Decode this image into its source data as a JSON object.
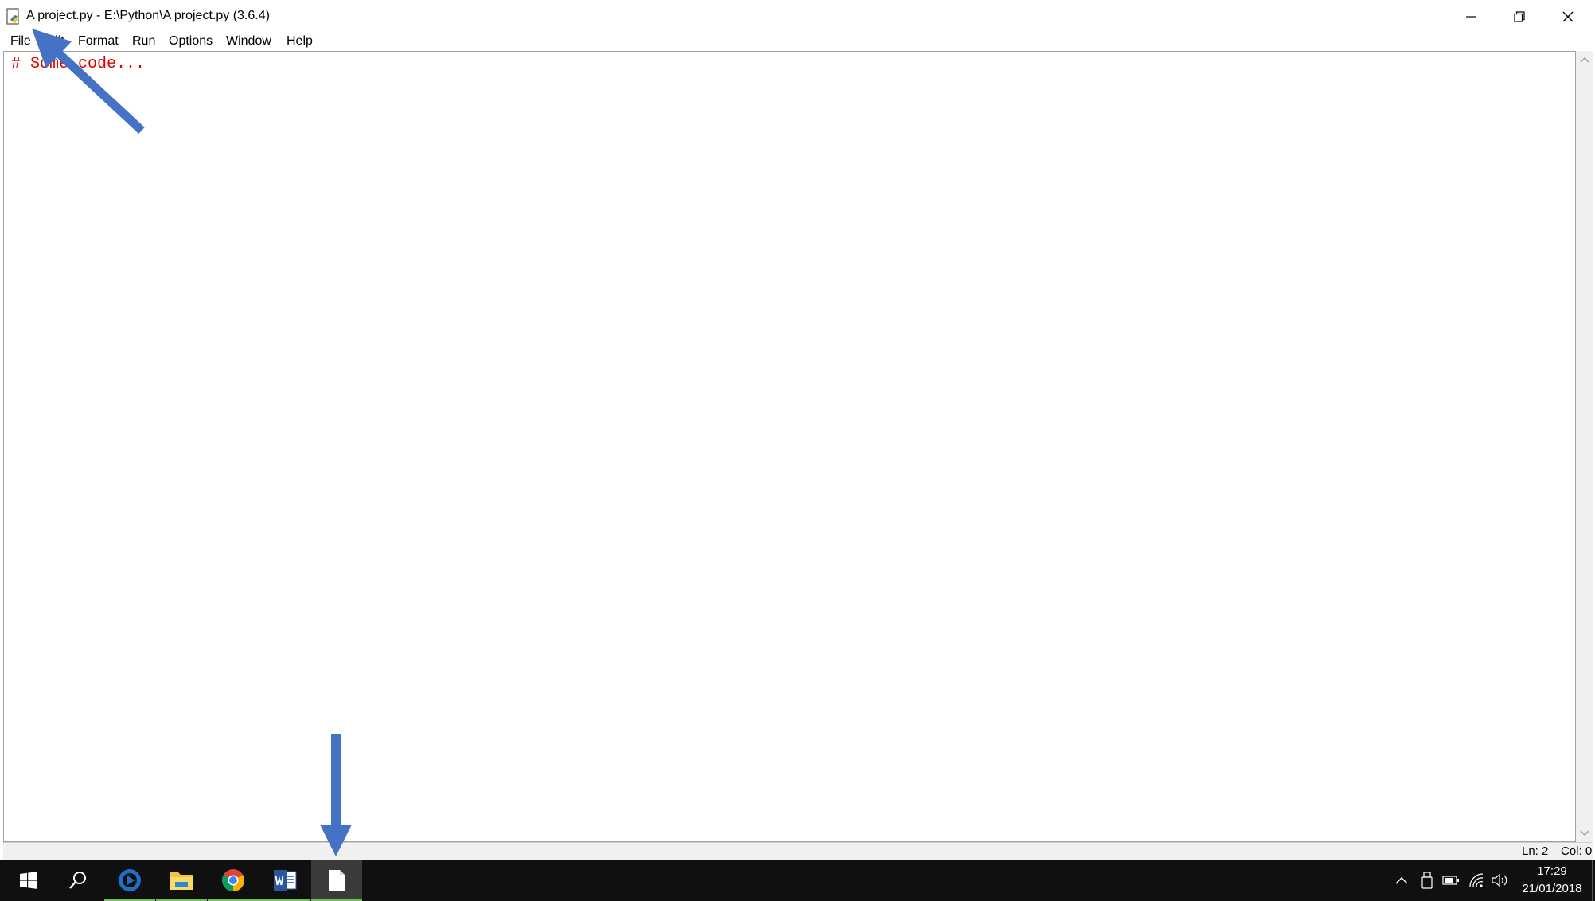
{
  "window": {
    "title": "A project.py - E:\\Python\\A project.py (3.6.4)",
    "controls": [
      "minimize-icon",
      "restore-icon",
      "close-icon"
    ]
  },
  "menu": {
    "file": "File",
    "edit": "Edit",
    "format": "Format",
    "run": "Run",
    "options": "Options",
    "window": "Window",
    "help": "Help"
  },
  "editor": {
    "code": "# Some code...",
    "code_color": "#dd0000"
  },
  "status": {
    "line": "Ln: 2",
    "col": "Col: 0"
  },
  "taskbar": {
    "apps": [
      "windows-start-icon",
      "search-icon",
      "cortana-icon",
      "file-explorer-icon",
      "chrome-icon",
      "word-icon",
      "idle-document-icon"
    ],
    "tray": [
      "chevron-up-icon",
      "usb-icon",
      "battery-icon",
      "wifi-icon",
      "volume-icon"
    ],
    "time": "17:29",
    "date": "21/01/2018"
  },
  "annotations": {
    "color": "#4472c4"
  }
}
